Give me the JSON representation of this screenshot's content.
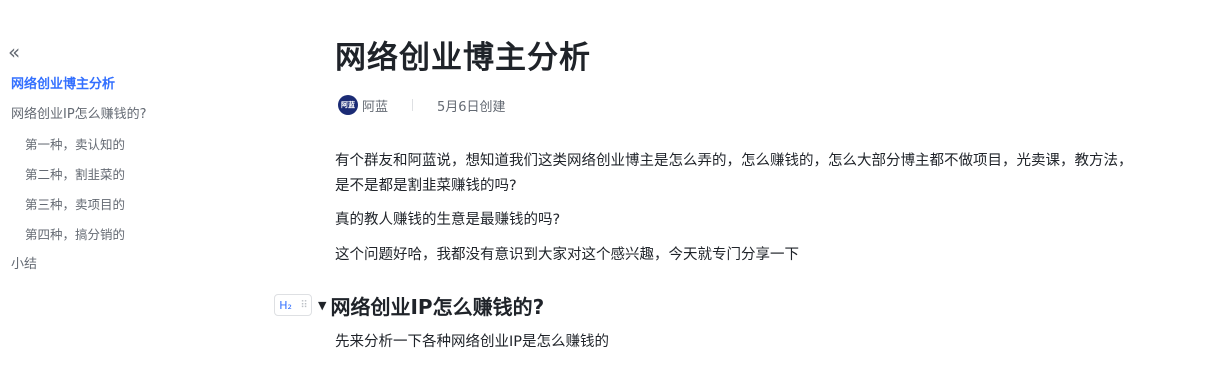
{
  "sidebar": {
    "collapse_icon": "«",
    "items": [
      {
        "label": "网络创业博主分析"
      },
      {
        "label": "网络创业IP怎么赚钱的?"
      },
      {
        "label": "第一种，卖认知的"
      },
      {
        "label": "第二种，割韭菜的"
      },
      {
        "label": "第三种，卖项目的"
      },
      {
        "label": "第四种，搞分销的"
      },
      {
        "label": "小结"
      }
    ]
  },
  "doc": {
    "title": "网络创业博主分析",
    "avatar_text": "阿蓝",
    "author": "阿蓝",
    "created": "5月6日创建",
    "paragraphs": [
      "有个群友和阿蓝说，想知道我们这类网络创业博主是怎么弄的，怎么赚钱的，怎么大部分博主都不做项目，光卖课，教方法，是不是都是割韭菜赚钱的吗?",
      "真的教人赚钱的生意是最赚钱的吗?",
      "这个问题好哈，我都没有意识到大家对这个感兴趣，今天就专门分享一下"
    ],
    "heading_handle": "H₂",
    "heading": "网络创业IP怎么赚钱的?",
    "heading_paragraph": "先来分析一下各种网络创业IP是怎么赚钱的"
  }
}
